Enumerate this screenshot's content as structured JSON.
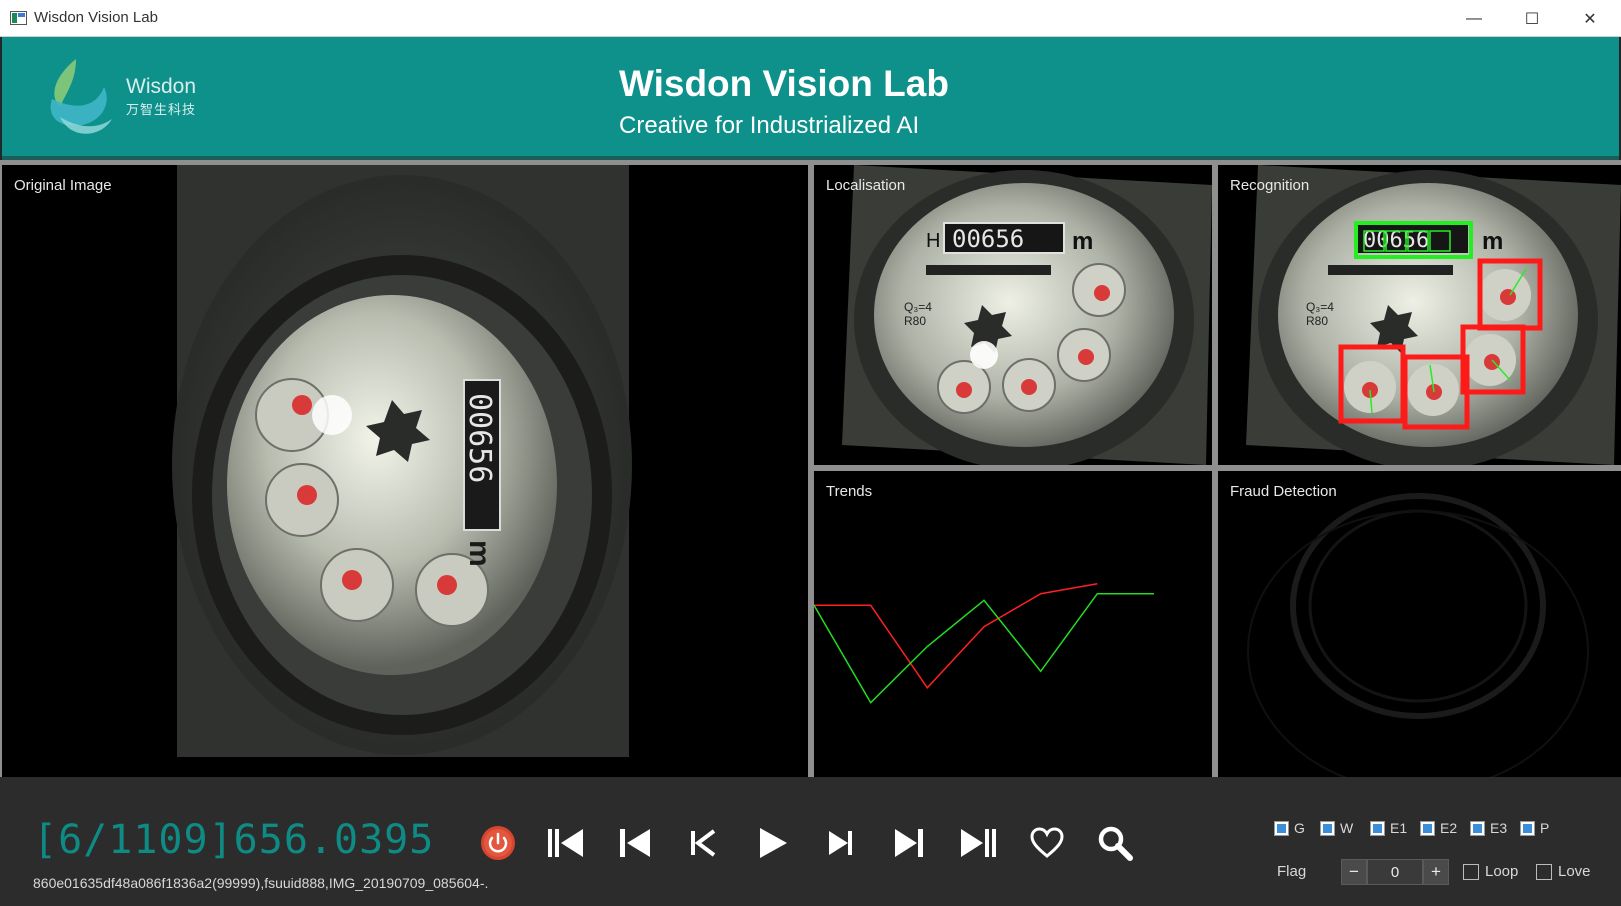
{
  "window": {
    "title": "Wisdon Vision Lab",
    "controls": {
      "minimize": "—",
      "maximize": "☐",
      "close": "✕"
    }
  },
  "banner": {
    "logo_word": "Wisdon",
    "logo_cn": "万智生科技",
    "title": "Wisdon Vision Lab",
    "subtitle": "Creative for Industrialized AI",
    "background": "#0e918a"
  },
  "panels": {
    "original": {
      "label": "Original Image"
    },
    "localisation": {
      "label": "Localisation",
      "reading": "00656",
      "unit": "m"
    },
    "recognition": {
      "label": "Recognition",
      "reading": "00656",
      "unit": "m"
    },
    "trends": {
      "label": "Trends"
    },
    "fraud": {
      "label": "Fraud Detection"
    }
  },
  "meter": {
    "h": "H",
    "reading": "00656",
    "unit": "m",
    "q": "Q₃=4",
    "r": "R80"
  },
  "chart_data": {
    "type": "line",
    "title": "Trends",
    "x": [
      0,
      1,
      2,
      3,
      4,
      5,
      6
    ],
    "series": [
      {
        "color": "#ff2020",
        "values": [
          0.55,
          0.55,
          0.05,
          0.42,
          0.62,
          0.68,
          null
        ]
      },
      {
        "color": "#22dd22",
        "values": [
          0.55,
          -0.04,
          0.3,
          0.58,
          0.15,
          0.62,
          0.62
        ]
      }
    ],
    "grid": false
  },
  "status": {
    "counter": "[6/1109]656.0395",
    "file": "860e01635df48a086f1836a2(99999),fsuuid888,IMG_20190709_085604-."
  },
  "toolbar": {
    "buttons": [
      "power-icon",
      "first-icon",
      "skip-back-icon",
      "prev-icon",
      "play-icon",
      "next-icon",
      "skip-forward-icon",
      "last-icon",
      "heart-icon",
      "search-icon"
    ]
  },
  "filters": [
    {
      "label": "G",
      "checked": true
    },
    {
      "label": "W",
      "checked": true
    },
    {
      "label": "E1",
      "checked": true
    },
    {
      "label": "E2",
      "checked": true
    },
    {
      "label": "E3",
      "checked": true
    },
    {
      "label": "P",
      "checked": true
    }
  ],
  "flag": {
    "label": "Flag",
    "value": "0",
    "minus": "−",
    "plus": "+"
  },
  "options": {
    "loop": "Loop",
    "love": "Love"
  },
  "colors": {
    "accent": "#0f8b85",
    "box_green": "#22ee22",
    "box_red": "#ff1a1a"
  }
}
